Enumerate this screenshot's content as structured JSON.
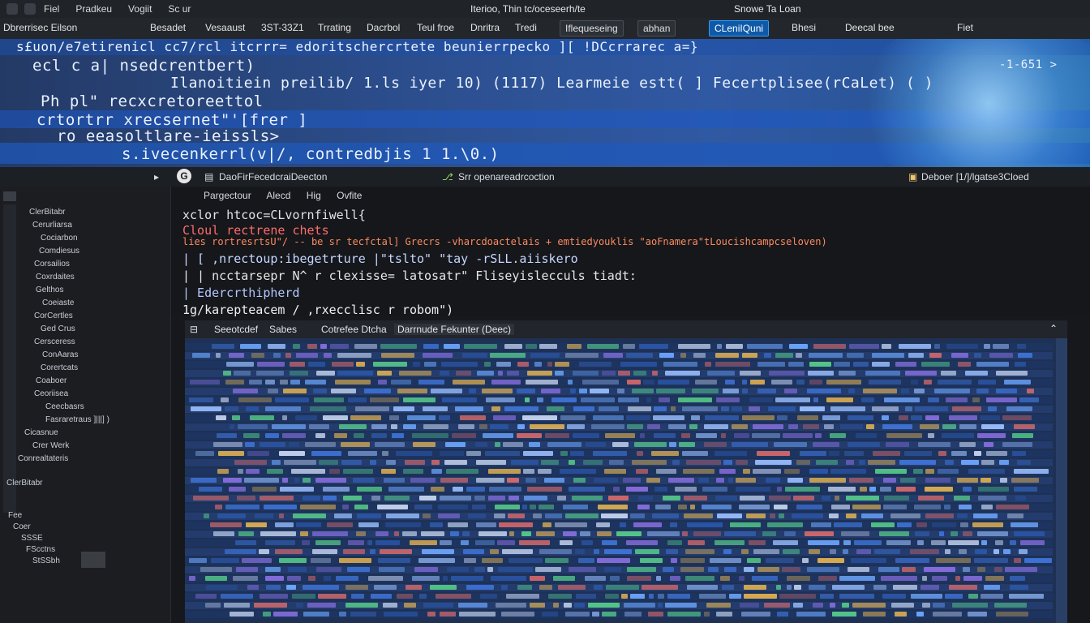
{
  "menubar": {
    "items": [
      "Fiel",
      "Pradkeu",
      "Vogiit",
      "Sc ur"
    ],
    "window_title": "Iterioo, Thin tc/oceseerh/te",
    "right_text": "Snowe  Ta  Loan"
  },
  "toolbar": {
    "left_label": "Dbrerrisec Eilson",
    "items": [
      "Besadet",
      "Vesaaust",
      "3ST-33Z1",
      "Trrating",
      "Dacrbol",
      "Teul froe",
      "Dnritra",
      "Tredi"
    ],
    "chip_1": "Iflequeseing",
    "chip_2": "abhan",
    "chip_active": "CLeniIQuni",
    "item_after": "Bhesi",
    "item_last": "Deecal bee",
    "far_right": "Fiet"
  },
  "banner": {
    "line1": "s£uon/e7etirenicl cc7/rcl  itcrrr= edoritschercrtete beunierrpecko ][ !DCcrrarec a=}",
    "line2": "ecl c a|  nsedcrentbert)",
    "line3": "Ilanoitiein preilib/   1.ls iyer 10)    (1117)    Learmeie estt( ] Fecertplisee(rCaLet)        ( )",
    "line4": "Ph pl\"  recxcretoreettol",
    "line5": "crtortrr  xrecsernet\"'[frer   ]",
    "line6": "ro eeasoltlare-ieissls>",
    "line7": "s.ivecenkerrl(v|/, contredbjis 1 1.\\0.)",
    "right_badge": "-1-651 >"
  },
  "crumbs": {
    "left_path": "DaoFirFecedcraiDeecton",
    "middle": "Srr  openareadrcoction",
    "right": "Deboer  [1/]/lgatse3Cloed"
  },
  "sidebar": {
    "items": [
      "ClerBitabr",
      "Cerurliarsa",
      "Cociarbon",
      "Comdiesus",
      "Corsailios",
      "Coxrdaites",
      "Gelthos",
      "Coeiaste",
      "CorCertles",
      "Ged Crus",
      "Cersceress",
      "ConAaras",
      "Corertcats",
      "Coaboer",
      "Ceoriisea",
      "Ceecbasrs",
      "Fasraretraus  ]|||]   )",
      "Cicasnue",
      "Crer Werk",
      "Conrealtateris"
    ],
    "bottom_items": [
      "Fee",
      "Coer",
      "SSSE",
      "FScctns",
      "StSSbh"
    ]
  },
  "editor": {
    "tabs": [
      "Pargectour",
      "Alecd",
      "Hig",
      "Ovfite"
    ],
    "lines": [
      "xclor htcoc=CLvornfiwell{",
      "Cloul rectrene chets",
      "lies  rortresrtsU\"/ -- be sr  tecfctal] Grecrs  -vharcdoactelais +  emtiedyouklis \"aoFnamera\"tLoucishcampcseloven)",
      "  | [ ,nrectoup:ibegetrture  |\"tslto\"  \"tay -rSLL.aiiskero",
      "  | |  ncctarsepr  N^ r  clexisse= latosatr\"  Fliseyislecculs tiadt:",
      "  |    Edercrthipherd",
      "1g/karepteacem / ,rxecclisc  r robom\")"
    ]
  },
  "panel": {
    "tabs": [
      "Seeotcdef",
      "Sabes",
      "Cotrefee Dtcha",
      "Darrnude Fekunter (Deec)"
    ]
  },
  "colors": {
    "accent": "#2ea0ff",
    "banner_blue": "#2c4f8f",
    "panel_blue": "#1e3154"
  }
}
